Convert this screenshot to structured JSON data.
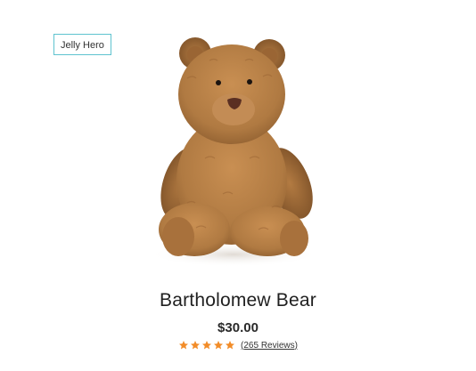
{
  "product": {
    "badge": "Jelly Hero",
    "image_alt_icon": "teddy-bear-image",
    "title": "Bartholomew Bear",
    "price": "$30.00",
    "rating": 5,
    "rating_max": 5,
    "reviews_label": "(265 Reviews)",
    "star_color": "#f28c28",
    "badge_border_color": "#5fc3cf"
  }
}
